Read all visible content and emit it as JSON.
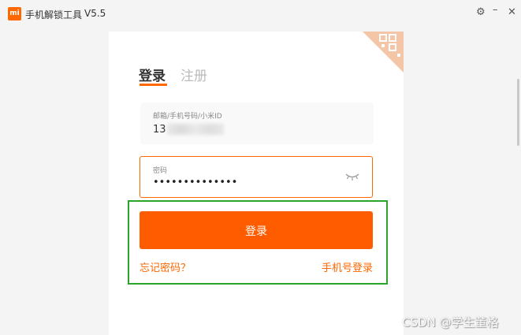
{
  "window": {
    "logo_text": "mi",
    "title": "手机解锁工具",
    "version": "V5.5",
    "controls": {
      "settings_icon": "gear-icon",
      "minimize_icon": "minimize-icon",
      "close_icon": "close-icon"
    }
  },
  "login": {
    "tabs": {
      "login": "登录",
      "register": "注册"
    },
    "account": {
      "label": "邮箱/手机号码/小米ID",
      "value": "13"
    },
    "password": {
      "label": "密码",
      "value": "••••••••••••••",
      "icon": "eye-closed-icon"
    },
    "submit_label": "登录",
    "forgot_label": "忘记密码？",
    "phone_login_label": "手机号登录"
  },
  "watermark": "CSDN @学生董格",
  "colors": {
    "accent": "#ff6700",
    "highlight_box": "#2aa52a"
  }
}
